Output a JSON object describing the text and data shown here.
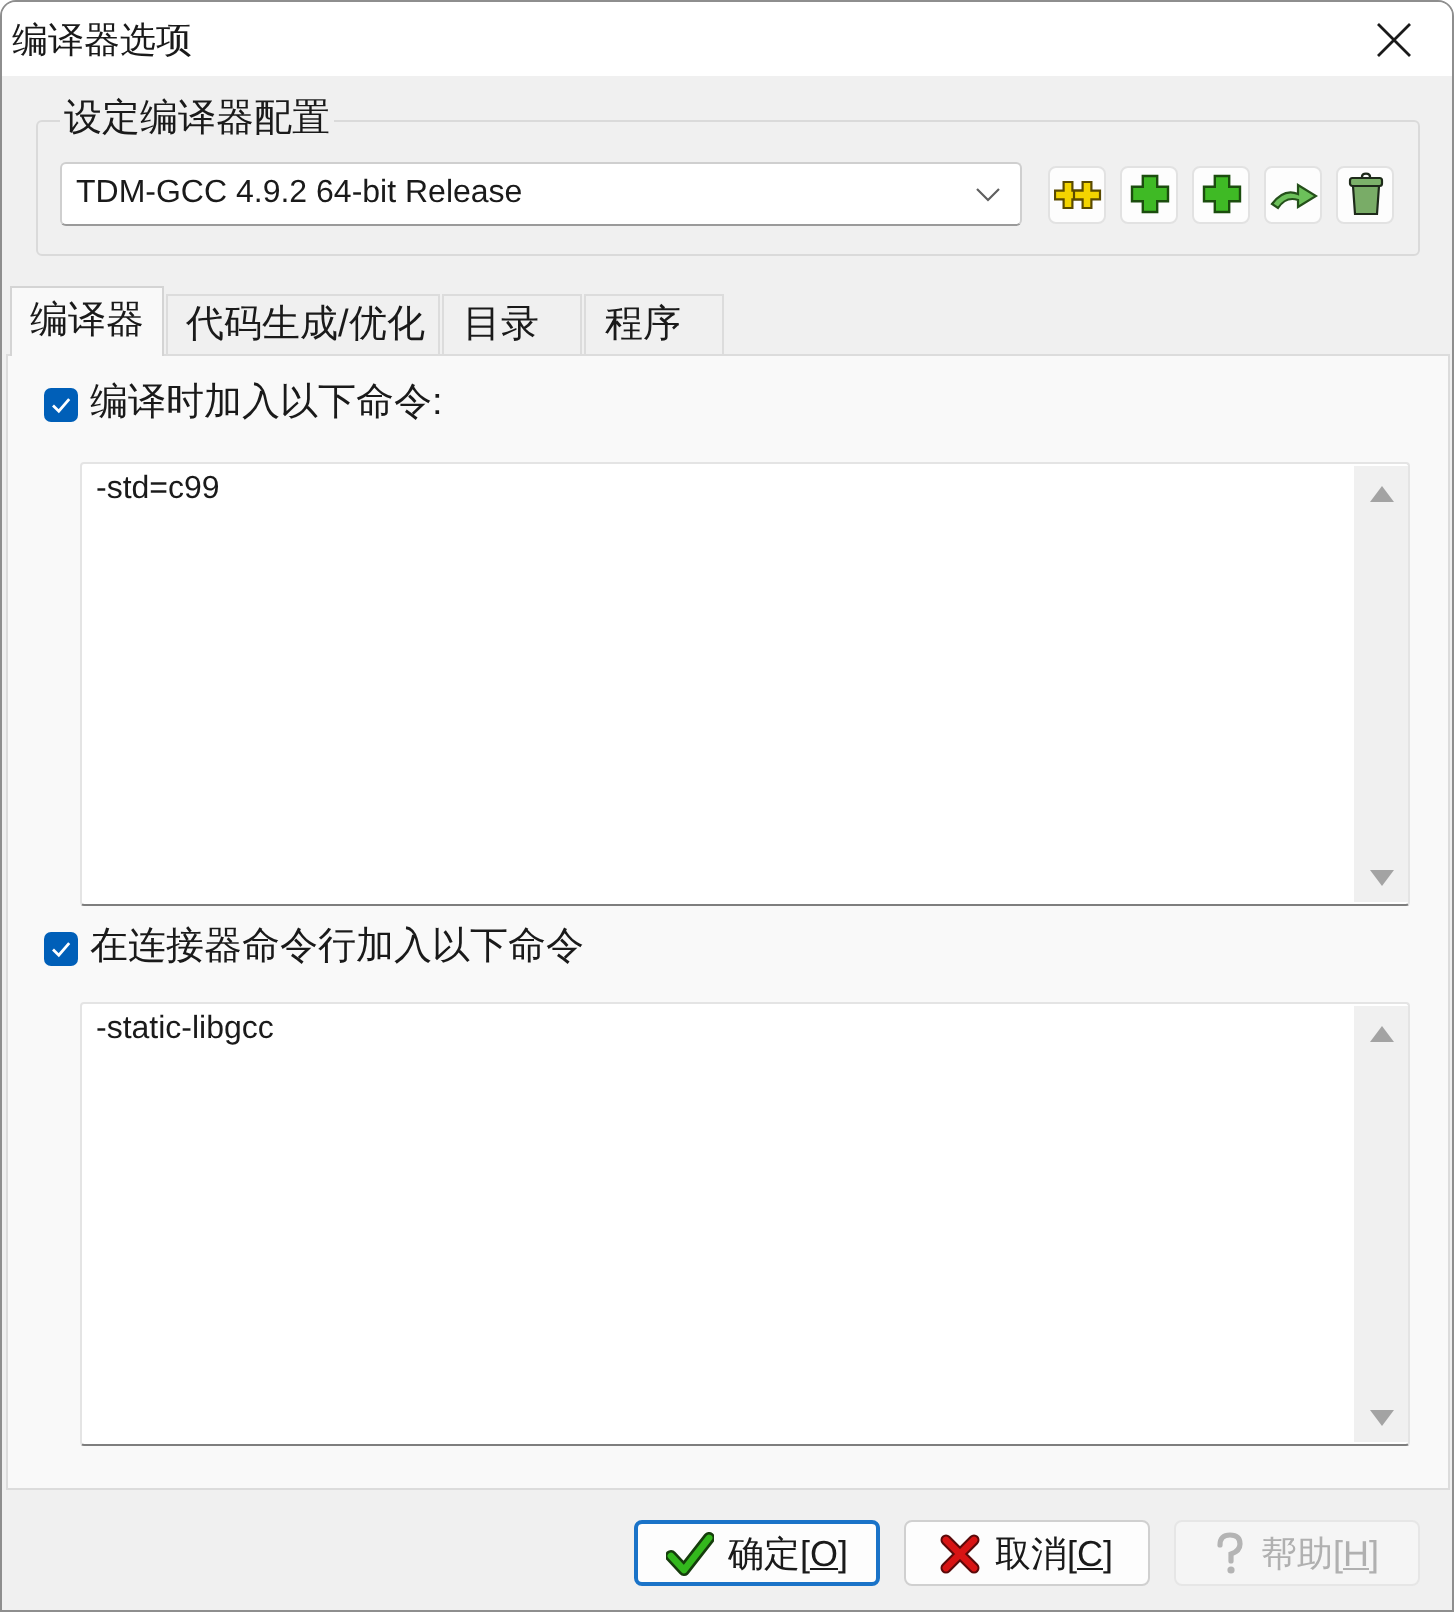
{
  "window": {
    "title": "编译器选项"
  },
  "compiler_set": {
    "label": "设定编译器配置",
    "value": "TDM-GCC 4.9.2 64-bit Release"
  },
  "tabs": [
    {
      "label": "编译器",
      "selected": true
    },
    {
      "label": "代码生成/优化",
      "selected": false
    },
    {
      "label": "目录",
      "selected": false
    },
    {
      "label": "程序",
      "selected": false
    }
  ],
  "options": [
    {
      "label": "编译时加入以下命令:",
      "checked": true,
      "value": "-std=c99"
    },
    {
      "label": "在连接器命令行加入以下命令",
      "checked": true,
      "value": "-static-libgcc"
    }
  ],
  "buttons": [
    {
      "kind": "ok",
      "text_before": "确定[",
      "accelerator": "O",
      "text_after": "]",
      "default": true,
      "disabled": false
    },
    {
      "kind": "cancel",
      "text_before": "取消[",
      "accelerator": "C",
      "text_after": "]",
      "default": false,
      "disabled": false
    },
    {
      "kind": "help",
      "text_before": "帮助[",
      "accelerator": "H",
      "text_after": "]",
      "default": false,
      "disabled": true
    }
  ]
}
